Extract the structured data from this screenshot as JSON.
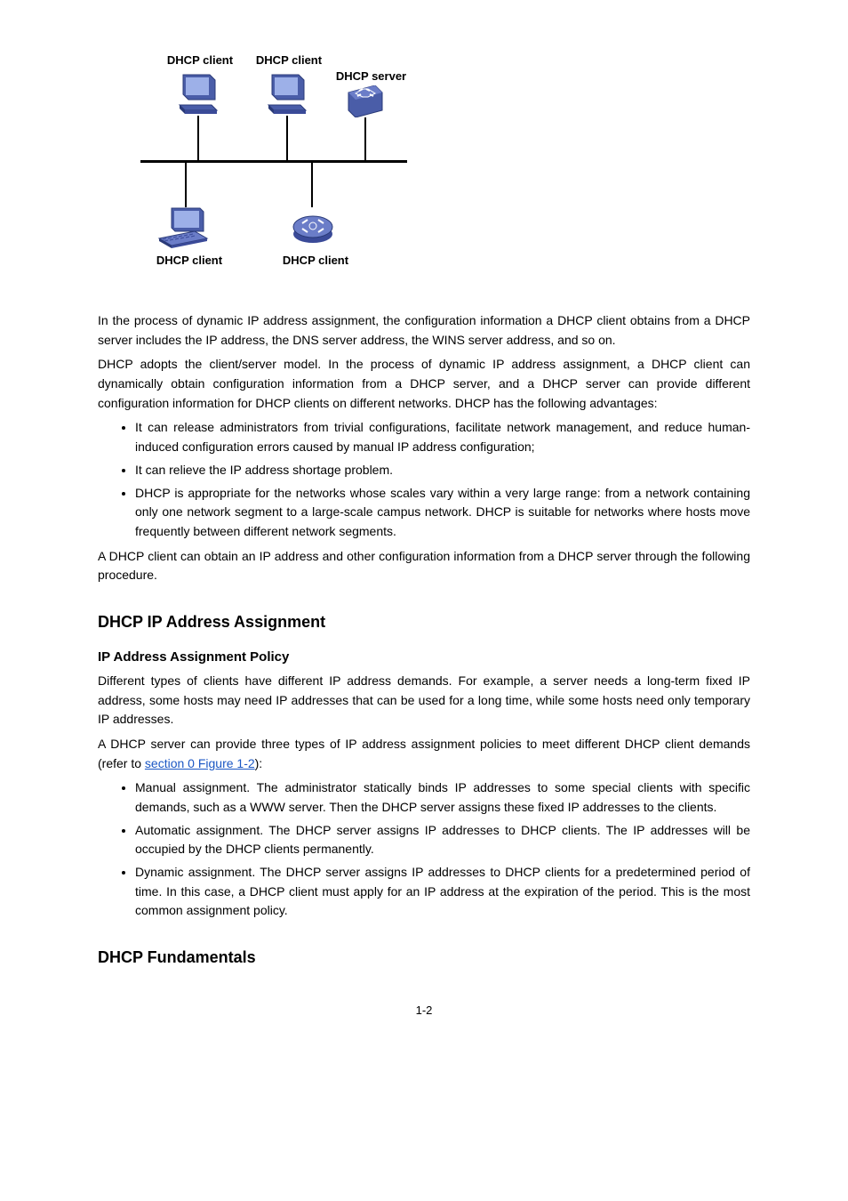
{
  "figure": {
    "labels": {
      "client_top_left": "DHCP client",
      "client_top_right": "DHCP client",
      "server": "DHCP server",
      "client_bottom_left": "DHCP client",
      "client_bottom_right": "DHCP client"
    }
  },
  "text": {
    "p_intro": "In the process of dynamic IP address assignment, the configuration information a DHCP client obtains from a DHCP server includes the IP address, the DNS server address, the WINS server address, and so on.",
    "p_advantages_intro": "DHCP adopts the client/server model. In the process of dynamic IP address assignment, a DHCP client can dynamically obtain configuration information from a DHCP server, and a DHCP server can provide different configuration information for DHCP clients on different networks. DHCP has the following advantages:",
    "li_adv_1": "It can release administrators from trivial configurations, facilitate network management, and reduce human-induced configuration errors caused by manual IP address configuration;",
    "li_adv_2": "It can relieve the IP address shortage problem.",
    "li_adv_3": "DHCP is appropriate for the networks whose scales vary within a very large range: from a network containing only one network segment to a large-scale campus network. DHCP is suitable for networks where hosts move frequently between different network segments.",
    "p_fundamentals_intro": "A DHCP client can obtain an IP address and other configuration information from a DHCP server through the following procedure.",
    "h_ip_assignment": "DHCP IP Address Assignment",
    "h_ip_policy": "IP Address Assignment Policy",
    "p_policy_1": "Different types of clients have different IP address demands. For example, a server needs a long-term fixed IP address, some hosts may need IP addresses that can be used for a long time, while some hosts need only temporary IP addresses.",
    "p_policy_2": "A DHCP server can provide three types of IP address assignment policies to meet different DHCP client demands (refer to ",
    "p_policy_2_xref": "section 0 Figure 1-2",
    "p_policy_2_tail": "):",
    "li_policy_1": "Manual assignment. The administrator statically binds IP addresses to some special clients with specific demands, such as a WWW server. Then the DHCP server assigns these fixed IP addresses to the clients.",
    "li_policy_2": "Automatic assignment. The DHCP server assigns IP addresses to DHCP clients. The IP addresses will be occupied by the DHCP clients permanently.",
    "li_policy_3": "Dynamic assignment. The DHCP server assigns IP addresses to DHCP clients for a predetermined period of time. In this case, a DHCP client must apply for an IP address at the expiration of the period. This is the most common assignment policy.",
    "h_fundamentals": "DHCP Fundamentals",
    "page_number": "1-2"
  }
}
